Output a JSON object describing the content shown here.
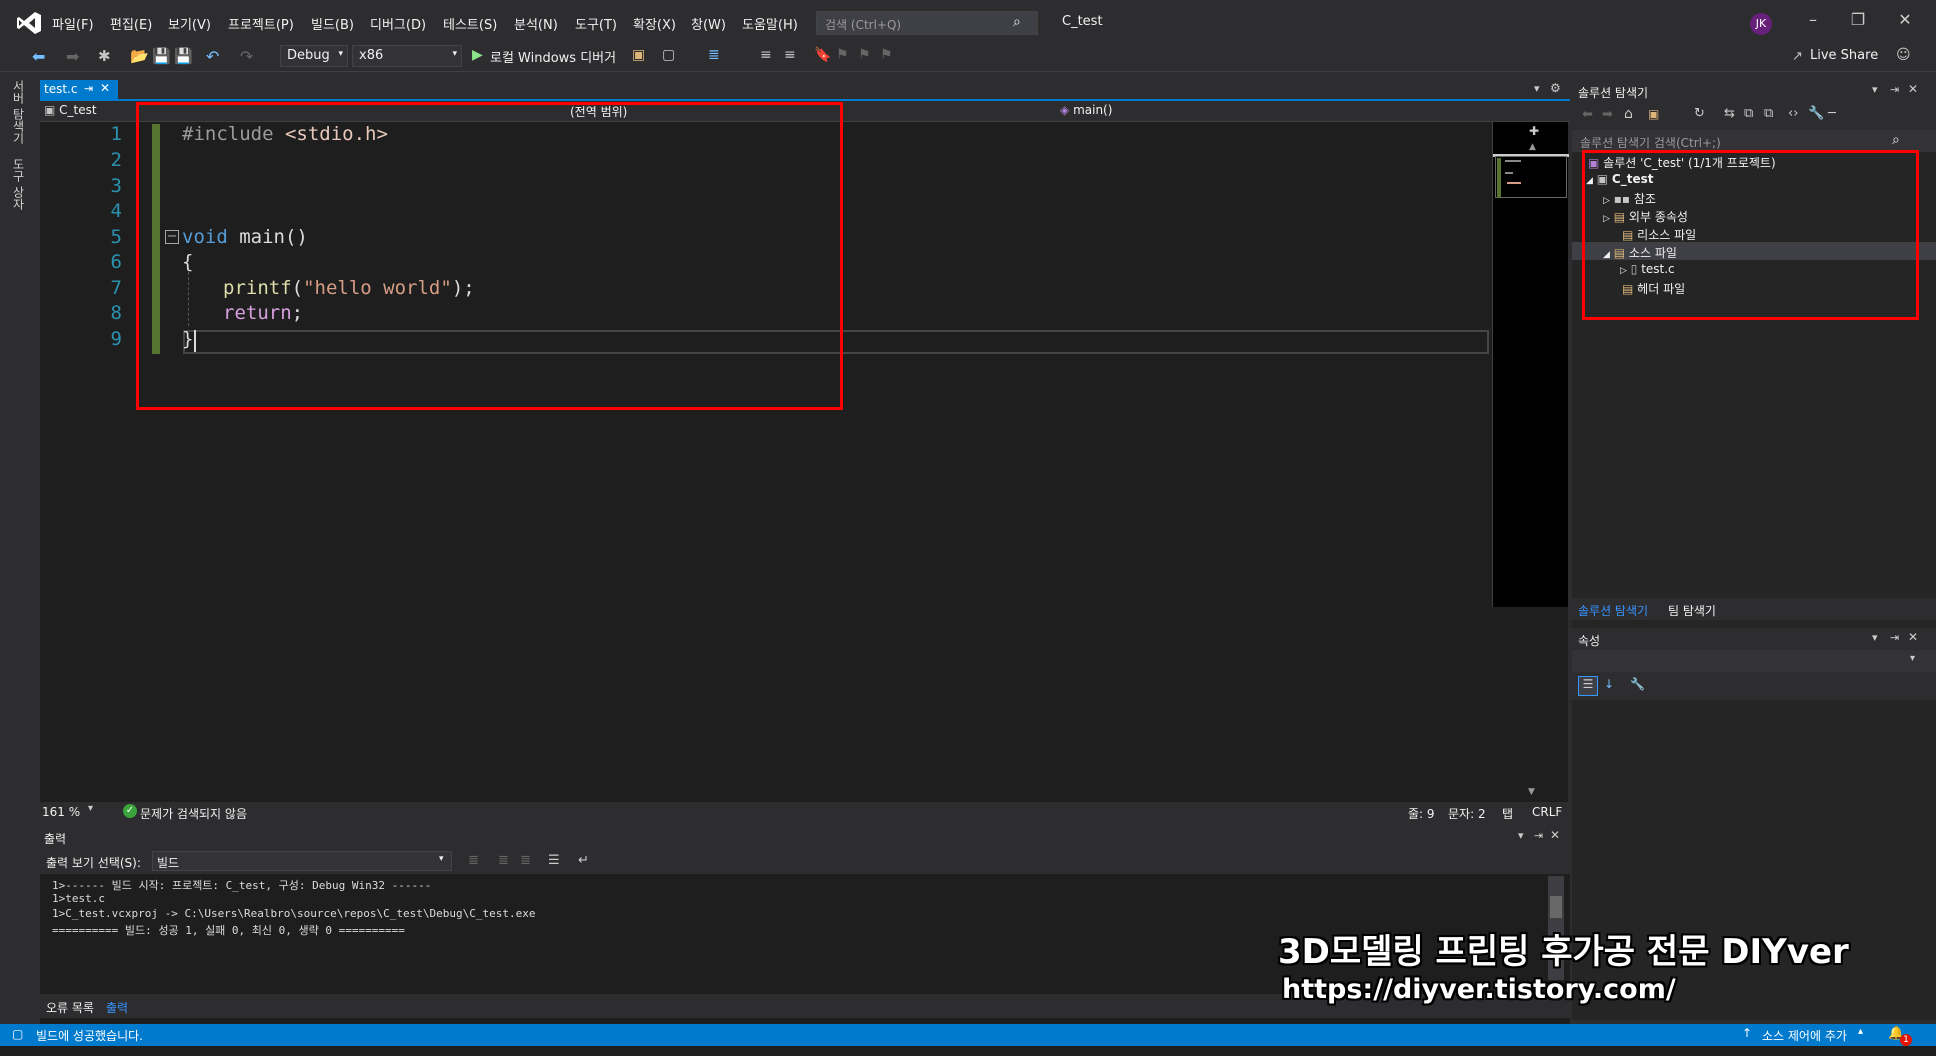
{
  "menu": [
    "파일(F)",
    "편집(E)",
    "보기(V)",
    "프로젝트(P)",
    "빌드(B)",
    "디버그(D)",
    "테스트(S)",
    "분석(N)",
    "도구(T)",
    "확장(X)",
    "창(W)",
    "도움말(H)"
  ],
  "search": {
    "placeholder": "검색 (Ctrl+Q)"
  },
  "window_title": "C_test",
  "user_initials": "JK",
  "toolbar": {
    "config": "Debug",
    "platform": "x86",
    "run_label": "로컬 Windows 디버거",
    "live_share": "Live Share"
  },
  "left_rail": {
    "server_explorer": "서버 탐색기",
    "toolbox": "도구 상자"
  },
  "editor": {
    "tab_label": "test.c",
    "nav_project": "C_test",
    "nav_scope": "(전역 범위)",
    "nav_member": "main()",
    "line_numbers": [
      "1",
      "2",
      "3",
      "4",
      "5",
      "6",
      "7",
      "8",
      "9"
    ],
    "code": {
      "line1_directive": "#include",
      "line1_header": "<stdio.h>",
      "line5_keyword": "void",
      "line5_rest": "main()",
      "line6": "{",
      "line7_func": "printf",
      "line7_open": "(",
      "line7_string": "\"hello world\"",
      "line7_close": ");",
      "line8_keyword": "return",
      "line8_rest": ";",
      "line9": "}"
    },
    "zoom": "161 %",
    "issues": "문제가 검색되지 않음",
    "line_pos": "줄: 9",
    "col_pos": "문자: 2",
    "indent": "탭",
    "eol": "CRLF"
  },
  "output": {
    "title": "출력",
    "source_label": "출력 보기 선택(S):",
    "source_value": "빌드",
    "lines": [
      "1>------ 빌드 시작: 프로젝트: C_test, 구성: Debug Win32 ------",
      "1>test.c",
      "1>C_test.vcxproj -> C:\\Users\\Realbro\\source\\repos\\C_test\\Debug\\C_test.exe",
      "========== 빌드: 성공 1, 실패 0, 최신 0, 생략 0 =========="
    ],
    "tab_errors": "오류 목록",
    "tab_output": "출력"
  },
  "solution_explorer": {
    "title": "솔루션 탐색기",
    "search_placeholder": "솔루션 탐색기 검색(Ctrl+;)",
    "items": [
      {
        "label": "솔루션 'C_test' (1/1개 프로젝트)"
      },
      {
        "label": "C_test"
      },
      {
        "label": "참조"
      },
      {
        "label": "외부 종속성"
      },
      {
        "label": "리소스 파일"
      },
      {
        "label": "소스 파일"
      },
      {
        "label": "test.c"
      },
      {
        "label": "헤더 파일"
      }
    ],
    "tab_solution": "솔루션 탐색기",
    "tab_team": "팀 탐색기"
  },
  "properties": {
    "title": "속성"
  },
  "statusbar": {
    "message": "빌드에 성공했습니다.",
    "source_control": "소스 제어에 추가",
    "notifications": "1"
  },
  "watermark": {
    "line1": "3D모델링 프린팅 후가공 전문 DIYver",
    "line2": "https://diyver.tistory.com/"
  },
  "colors": {
    "accent": "#007acc",
    "editor_bg": "#1e1e1e",
    "highlight_box": "#ff0000"
  }
}
